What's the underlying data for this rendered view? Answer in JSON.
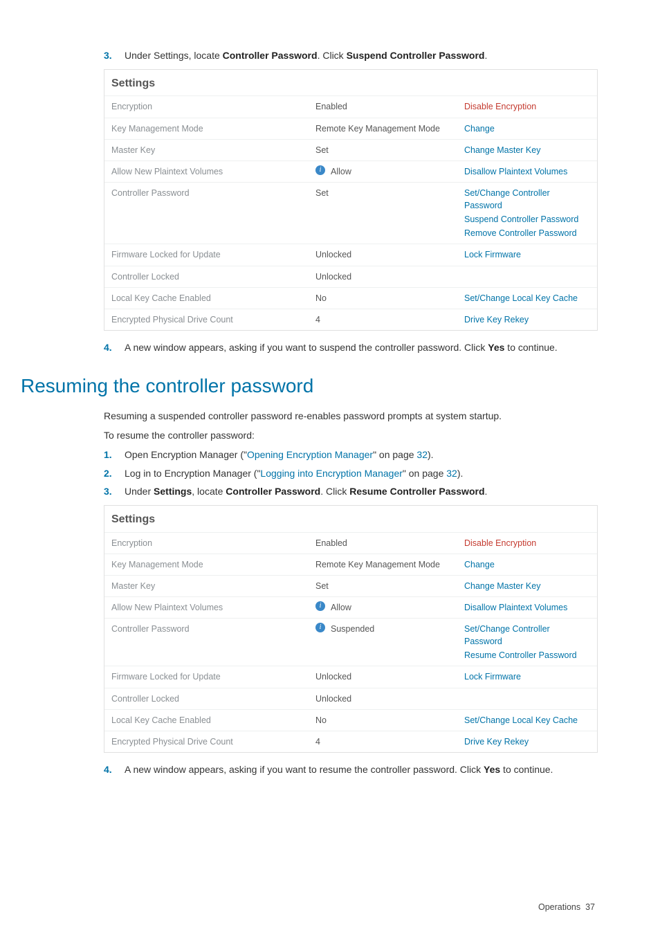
{
  "step3a": {
    "num": "3.",
    "prefix": "Under Settings, locate ",
    "strong1": "Controller Password",
    "mid": ". Click ",
    "strong2": "Suspend Controller Password",
    "suffix": "."
  },
  "panelA": {
    "title": "Settings",
    "rows": [
      {
        "label": "Encryption",
        "val": "Enabled",
        "info": false,
        "actions": [
          {
            "t": "Disable Encryption",
            "c": "link-red"
          }
        ]
      },
      {
        "label": "Key Management Mode",
        "val": "Remote Key Management Mode",
        "info": false,
        "actions": [
          {
            "t": "Change",
            "c": "link-blue"
          }
        ]
      },
      {
        "label": "Master Key",
        "val": "Set",
        "info": false,
        "actions": [
          {
            "t": "Change Master Key",
            "c": "link-blue"
          }
        ]
      },
      {
        "label": "Allow New Plaintext Volumes",
        "val": "Allow",
        "info": true,
        "actions": [
          {
            "t": "Disallow Plaintext Volumes",
            "c": "link-blue"
          }
        ]
      },
      {
        "label": "Controller Password",
        "val": "Set",
        "info": false,
        "actions": [
          {
            "t": "Set/Change Controller Password",
            "c": "link-blue"
          },
          {
            "t": "Suspend Controller Password",
            "c": "link-blue"
          },
          {
            "t": "Remove Controller Password",
            "c": "link-blue"
          }
        ]
      },
      {
        "label": "Firmware Locked for Update",
        "val": "Unlocked",
        "info": false,
        "actions": [
          {
            "t": "Lock Firmware",
            "c": "link-blue"
          }
        ]
      },
      {
        "label": "Controller Locked",
        "val": "Unlocked",
        "info": false,
        "actions": []
      },
      {
        "label": "Local Key Cache Enabled",
        "val": "No",
        "info": false,
        "actions": [
          {
            "t": "Set/Change Local Key Cache",
            "c": "link-blue"
          }
        ]
      },
      {
        "label": "Encrypted Physical Drive Count",
        "val": "4",
        "info": false,
        "actions": [
          {
            "t": "Drive Key Rekey",
            "c": "link-blue"
          }
        ]
      }
    ]
  },
  "step4a": {
    "num": "4.",
    "prefix": "A new window appears, asking if you want to suspend the controller password. Click ",
    "strong": "Yes",
    "suffix": " to continue."
  },
  "heading": "Resuming the controller password",
  "para1": "Resuming a suspended controller password re-enables password prompts at system startup.",
  "para2": "To resume the controller password:",
  "step1b": {
    "num": "1.",
    "prefix": "Open Encryption Manager (\"",
    "link": "Opening Encryption Manager",
    "mid": "\" on page ",
    "page": "32",
    "suffix": ")."
  },
  "step2b": {
    "num": "2.",
    "prefix": "Log in to Encryption Manager (\"",
    "link": "Logging into Encryption Manager",
    "mid": "\" on page ",
    "page": "32",
    "suffix": ")."
  },
  "step3b": {
    "num": "3.",
    "prefix": "Under ",
    "strong0": "Settings",
    "mid0": ", locate ",
    "strong1": "Controller Password",
    "mid": ". Click ",
    "strong2": "Resume Controller Password",
    "suffix": "."
  },
  "panelB": {
    "title": "Settings",
    "rows": [
      {
        "label": "Encryption",
        "val": "Enabled",
        "info": false,
        "actions": [
          {
            "t": "Disable Encryption",
            "c": "link-red"
          }
        ]
      },
      {
        "label": "Key Management Mode",
        "val": "Remote Key Management Mode",
        "info": false,
        "actions": [
          {
            "t": "Change",
            "c": "link-blue"
          }
        ]
      },
      {
        "label": "Master Key",
        "val": "Set",
        "info": false,
        "actions": [
          {
            "t": "Change Master Key",
            "c": "link-blue"
          }
        ]
      },
      {
        "label": "Allow New Plaintext Volumes",
        "val": "Allow",
        "info": true,
        "actions": [
          {
            "t": "Disallow Plaintext Volumes",
            "c": "link-blue"
          }
        ]
      },
      {
        "label": "Controller Password",
        "val": "Suspended",
        "info": true,
        "actions": [
          {
            "t": "Set/Change Controller Password",
            "c": "link-blue"
          },
          {
            "t": "Resume Controller Password",
            "c": "link-blue"
          }
        ]
      },
      {
        "label": "Firmware Locked for Update",
        "val": "Unlocked",
        "info": false,
        "actions": [
          {
            "t": "Lock Firmware",
            "c": "link-blue"
          }
        ]
      },
      {
        "label": "Controller Locked",
        "val": "Unlocked",
        "info": false,
        "actions": []
      },
      {
        "label": "Local Key Cache Enabled",
        "val": "No",
        "info": false,
        "actions": [
          {
            "t": "Set/Change Local Key Cache",
            "c": "link-blue"
          }
        ]
      },
      {
        "label": "Encrypted Physical Drive Count",
        "val": "4",
        "info": false,
        "actions": [
          {
            "t": "Drive Key Rekey",
            "c": "link-blue"
          }
        ]
      }
    ]
  },
  "step4b": {
    "num": "4.",
    "prefix": "A new window appears, asking if you want to resume the controller password. Click ",
    "strong": "Yes",
    "suffix": " to continue."
  },
  "footer": {
    "section": "Operations",
    "page": "37"
  }
}
